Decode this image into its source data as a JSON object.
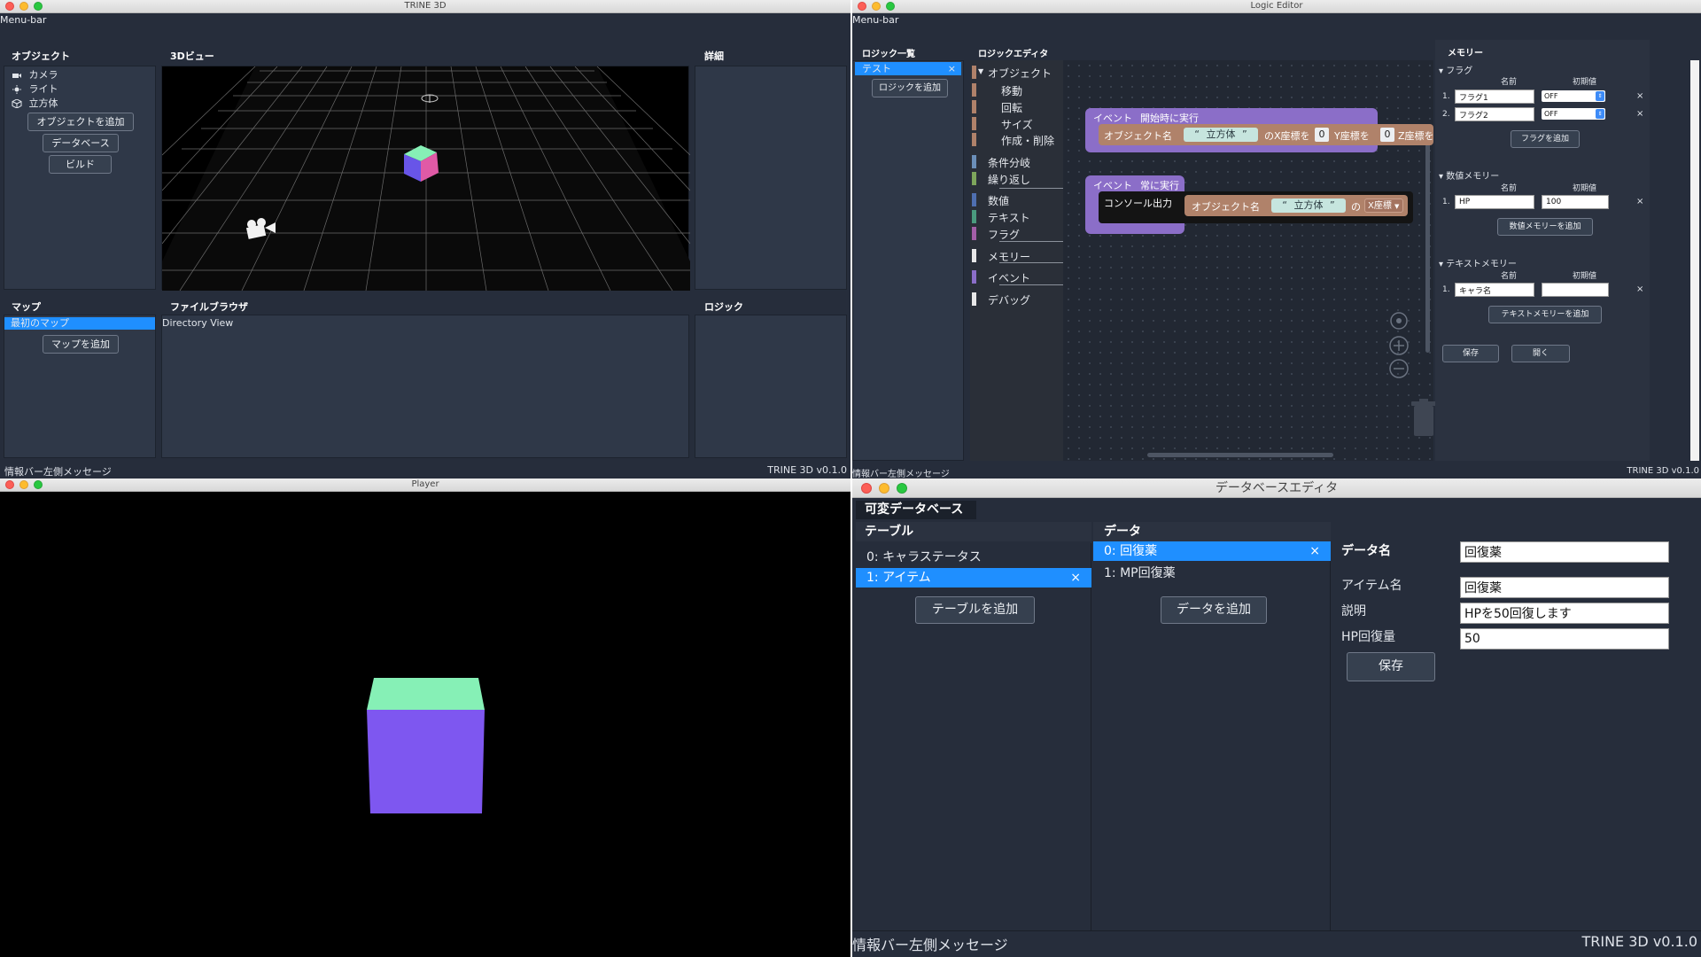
{
  "trine_window": {
    "title": "TRINE 3D",
    "menu_bar": "Menu-bar",
    "object_panel": {
      "header": "オブジェクト",
      "items": [
        {
          "icon": "camera-icon",
          "label": "カメラ"
        },
        {
          "icon": "sun-icon",
          "label": "ライト"
        },
        {
          "icon": "cube-icon",
          "label": "立方体"
        }
      ],
      "add_object": "オブジェクトを追加",
      "database": "データベース",
      "build": "ビルド"
    },
    "view3d_header": "3Dビュー",
    "details_header": "詳細",
    "map_panel": {
      "header": "マップ",
      "items": [
        "最初のマップ"
      ],
      "add_map": "マップを追加"
    },
    "file_browser": {
      "header": "ファイルブラウザ",
      "content": "Directory View"
    },
    "logic_header": "ロジック",
    "status_left": "情報バー左側メッセージ",
    "status_right": "TRINE 3D v0.1.0"
  },
  "logic_window": {
    "title": "Logic Editor",
    "menu_bar": "Menu-bar",
    "logic_list": {
      "header": "ロジック一覧",
      "items": [
        "テスト"
      ],
      "add_logic": "ロジックを追加"
    },
    "logic_editor": {
      "header": "ロジックエディタ",
      "categories": [
        {
          "label": "オブジェクト",
          "color": "#b0826a"
        },
        {
          "label": "移動",
          "color": "#b0826a"
        },
        {
          "label": "回転",
          "color": "#b0826a"
        },
        {
          "label": "サイズ",
          "color": "#b0826a"
        },
        {
          "label": "作成・削除",
          "color": "#b0826a"
        },
        {
          "label": "条件分岐",
          "color": "#6b8fb8"
        },
        {
          "label": "繰り返し",
          "color": "#7ea65b"
        },
        {
          "label": "数値",
          "color": "#4f6fb0"
        },
        {
          "label": "テキスト",
          "color": "#4a9b7e"
        },
        {
          "label": "フラグ",
          "color": "#a35ea7"
        },
        {
          "label": "メモリー",
          "color": "#e8e8e8"
        },
        {
          "label": "イベント",
          "color": "#8b6ec8"
        },
        {
          "label": "デバッグ",
          "color": "#e8e8e8"
        }
      ]
    },
    "blocks": {
      "event1": {
        "label": "イベント",
        "trigger": "開始時に実行"
      },
      "set_pos": {
        "obj_label": "オブジェクト名",
        "obj_value": "立方体",
        "x_label": "のX座標を",
        "x_value": "0",
        "y_label": "Y座標を",
        "y_value": "0",
        "z_label": "Z座標を"
      },
      "event2": {
        "label": "イベント",
        "trigger": "常に実行"
      },
      "console": {
        "label": "コンソール出力",
        "obj_label": "オブジェクト名",
        "obj_value": "立方体",
        "of": "の",
        "prop": "X座標"
      },
      "quote_open": "“",
      "quote_close": "”"
    },
    "memory": {
      "header": "メモリー",
      "flag": {
        "header": "フラグ",
        "col_name": "名前",
        "col_init": "初期値",
        "rows": [
          {
            "no": "1.",
            "name": "フラグ1",
            "init": "OFF"
          },
          {
            "no": "2.",
            "name": "フラグ2",
            "init": "OFF"
          }
        ],
        "add": "フラグを追加"
      },
      "number": {
        "header": "数値メモリー",
        "col_name": "名前",
        "col_init": "初期値",
        "rows": [
          {
            "no": "1.",
            "name": "HP",
            "init": "100"
          }
        ],
        "add": "数値メモリーを追加"
      },
      "text": {
        "header": "テキストメモリー",
        "col_name": "名前",
        "col_init": "初期値",
        "rows": [
          {
            "no": "1.",
            "name": "キャラ名",
            "init": ""
          }
        ],
        "add": "テキストメモリーを追加"
      },
      "save": "保存",
      "open": "開く",
      "delete_mark": "×"
    },
    "status_left": "情報バー左側メッセージ",
    "status_right": "TRINE 3D v0.1.0"
  },
  "player_window": {
    "title": "Player"
  },
  "db_window": {
    "title": "データベースエディタ",
    "tab": "可変データベース",
    "tables": {
      "header": "テーブル",
      "items": [
        "0: キャラステータス",
        "1: アイテム"
      ],
      "selected": 1,
      "add": "テーブルを追加"
    },
    "data": {
      "header": "データ",
      "items": [
        "0: 回復薬",
        "1: MP回復薬"
      ],
      "selected": 0,
      "add": "データを追加"
    },
    "fields": {
      "data_name_label": "データ名",
      "data_name_value": "回復薬",
      "item_name_label": "アイテム名",
      "item_name_value": "回復薬",
      "desc_label": "説明",
      "desc_value": "HPを50回復します",
      "hp_label": "HP回復量",
      "hp_value": "50"
    },
    "save": "保存",
    "delete_mark": "×",
    "status_left": "情報バー左側メッセージ",
    "status_right": "TRINE 3D v0.1.0"
  }
}
